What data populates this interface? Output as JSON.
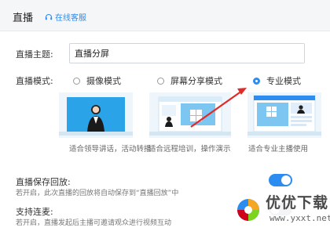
{
  "header": {
    "title": "直播",
    "support": "在线客服"
  },
  "topic": {
    "label": "直播主题:",
    "value": "直播分屏"
  },
  "mode": {
    "label": "直播模式:",
    "options": [
      {
        "label": "摄像模式",
        "caption": "适合领导讲话，活动转播",
        "selected": false
      },
      {
        "label": "屏幕分享模式",
        "caption": "适合远程培训，操作演示",
        "selected": false
      },
      {
        "label": "专业模式",
        "caption": "适合专业主播使用",
        "selected": true
      }
    ]
  },
  "save_replay": {
    "title": "直播保存回放:",
    "desc": "若开启，此次直播的回放将自动保存到“直播回放”中",
    "enabled": true
  },
  "co_stream": {
    "title": "支持连麦:",
    "desc": "若开启，直播发起后主播可邀请观众进行视频互动",
    "enabled": false
  },
  "watermark": {
    "text": "优优下载",
    "url": "www.yxxt.net"
  },
  "colors": {
    "accent": "#2d8cf0",
    "arrow": "#e02b2b"
  }
}
